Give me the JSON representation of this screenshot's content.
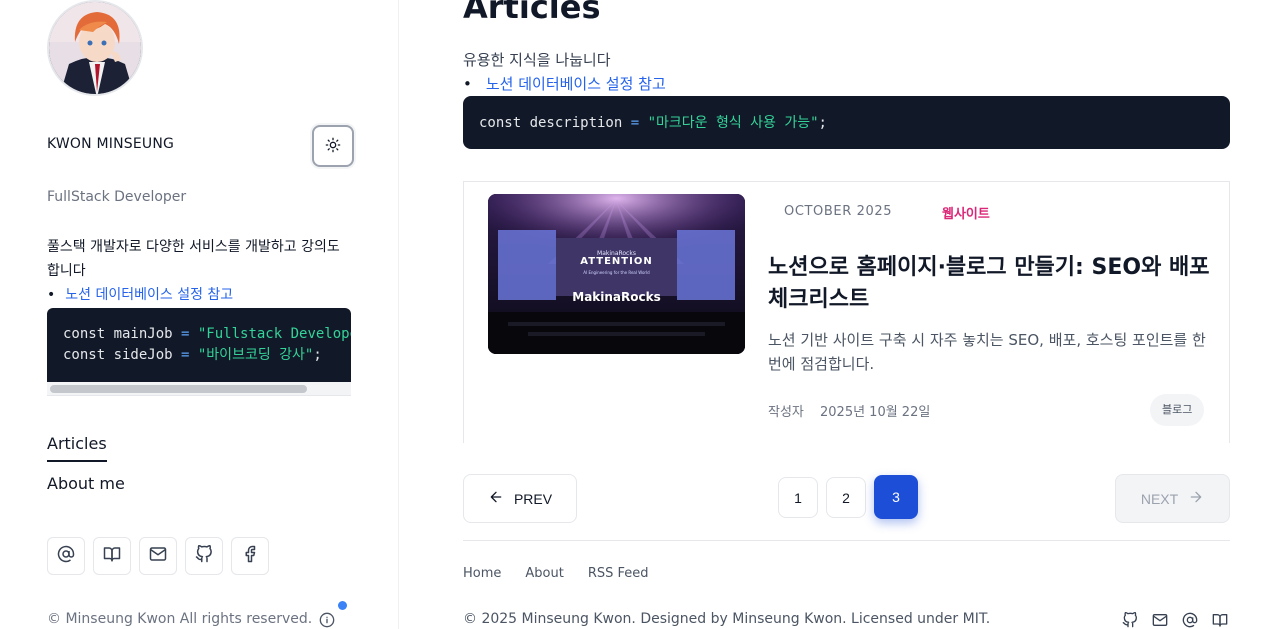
{
  "sidebar": {
    "name": "KWON MINSEUNG",
    "role": "FullStack Developer",
    "bio": "풀스택 개발자로 다양한 서비스를 개발하고 강의도 합니다",
    "link": "노션 데이터베이스 설정 참고",
    "code": {
      "line1_kw": "const mainJob",
      "line1_op": " = ",
      "line1_str": "\"Fullstack Developer\"",
      "line1_end": ";",
      "line2_kw": "const sideJob",
      "line2_op": " = ",
      "line2_str": "\"바이브코딩 강사\"",
      "line2_end": ";"
    },
    "nav": {
      "articles": "Articles",
      "about": "About me"
    },
    "social_icons": [
      "at-icon",
      "book-icon",
      "mail-icon",
      "github-icon",
      "facebook-icon"
    ],
    "copyright": "© Minseung Kwon All rights reserved."
  },
  "main": {
    "title": "Articles",
    "intro": "유용한 지식을 나눕니다",
    "link": "노션 데이터베이스 설정 참고",
    "code": {
      "kw": "const description",
      "op": " = ",
      "str": "\"마크다운 형식 사용 가능\"",
      "end": ";"
    },
    "card": {
      "date": "OCTOBER 2025",
      "category": "웹사이트",
      "title": "노션으로 홈페이지·블로그 만들기: SEO와 배포 체크리스트",
      "description": "노션 기반 사이트 구축 시 자주 놓치는 SEO, 배포, 호스팅 포인트를 한번에 점검합니다.",
      "author_label": "작성자",
      "published": "2025년 10월 22일",
      "tag": "블로그",
      "image_text": {
        "small": "MakinaRocks",
        "headline": "ATTENTION",
        "sub": "AI Engineering for the Real World",
        "brand": "MakinaRocks"
      }
    },
    "pagination": {
      "prev": "PREV",
      "next": "NEXT",
      "pages": [
        "1",
        "2",
        "3"
      ],
      "current": "3"
    },
    "footer": {
      "links": [
        "Home",
        "About",
        "RSS Feed"
      ],
      "copyright": "© 2025 Minseung Kwon. Designed by Minseung Kwon. Licensed under MIT.",
      "icons": [
        "github-icon",
        "mail-icon",
        "at-icon",
        "book-icon"
      ]
    }
  },
  "colors": {
    "accent": "#1d4ed8",
    "link": "#2563eb",
    "category": "#db2777",
    "code_bg": "#111827"
  }
}
